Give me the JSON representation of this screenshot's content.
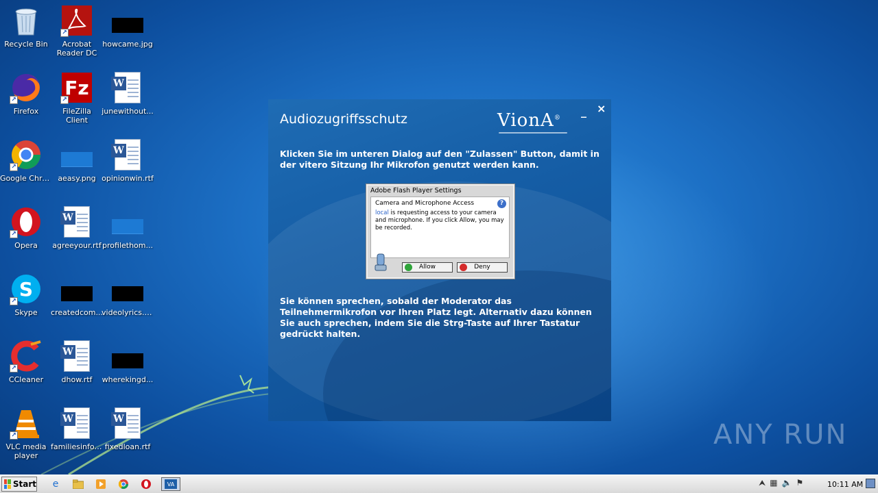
{
  "desktop": {
    "icons": [
      {
        "label": "Recycle Bin",
        "kind": "recycle-bin",
        "shortcut": false
      },
      {
        "label": "Acrobat Reader DC",
        "kind": "acrobat",
        "shortcut": true
      },
      {
        "label": "howcame.jpg",
        "kind": "black-image",
        "shortcut": false
      },
      {
        "label": "Firefox",
        "kind": "firefox",
        "shortcut": true
      },
      {
        "label": "FileZilla Client",
        "kind": "filezilla",
        "shortcut": true
      },
      {
        "label": "junewithout...",
        "kind": "word-doc",
        "shortcut": false
      },
      {
        "label": "Google Chrome",
        "kind": "chrome",
        "shortcut": true
      },
      {
        "label": "aeasy.png",
        "kind": "blue-image",
        "shortcut": false
      },
      {
        "label": "opinionwin.rtf",
        "kind": "word-doc",
        "shortcut": false
      },
      {
        "label": "Opera",
        "kind": "opera",
        "shortcut": true
      },
      {
        "label": "agreeyour.rtf",
        "kind": "word-doc",
        "shortcut": false
      },
      {
        "label": "profilethom...",
        "kind": "blue-image",
        "shortcut": false
      },
      {
        "label": "Skype",
        "kind": "skype",
        "shortcut": true
      },
      {
        "label": "createdcom...",
        "kind": "black-image",
        "shortcut": false
      },
      {
        "label": "videolyrics.jpg",
        "kind": "black-image",
        "shortcut": false
      },
      {
        "label": "CCleaner",
        "kind": "ccleaner",
        "shortcut": true
      },
      {
        "label": "dhow.rtf",
        "kind": "word-doc",
        "shortcut": false
      },
      {
        "label": "wherekingd...",
        "kind": "black-image",
        "shortcut": false
      },
      {
        "label": "VLC media player",
        "kind": "vlc",
        "shortcut": true
      },
      {
        "label": "familiesinfo.rtf",
        "kind": "word-doc",
        "shortcut": false
      },
      {
        "label": "fixedloan.rtf",
        "kind": "word-doc",
        "shortcut": false
      }
    ]
  },
  "dialog": {
    "title": "Audiozugriffsschutz",
    "logo": "VionA",
    "logo_mark": "®",
    "minimize": "_",
    "close": "×",
    "intro": "Klicken Sie im unteren Dialog auf den \"Zulassen\" Button, damit in der vitero Sitzung Ihr Mikrofon genutzt werden kann.",
    "outro": "Sie können sprechen, sobald der Moderator das Teilnehmermikrofon vor Ihren Platz legt. Alternativ dazu können Sie auch sprechen, indem Sie die Strg-Taste auf Ihrer Tastatur gedrückt halten."
  },
  "flash": {
    "title": "Adobe Flash Player Settings",
    "heading": "Camera and Microphone Access",
    "help": "?",
    "link": "local",
    "body": " is requesting access to your camera and microphone. If you click Allow, you may be recorded.",
    "allow": "Allow",
    "deny": "Deny"
  },
  "watermark": "ANY RUN",
  "taskbar": {
    "start": "Start",
    "clock": "10:11 AM"
  },
  "colors": {
    "dialog_bg": "#155da5",
    "desktop_bg": "#1c6fc4",
    "allow_green": "#2fa43a",
    "deny_red": "#d42a2a"
  }
}
